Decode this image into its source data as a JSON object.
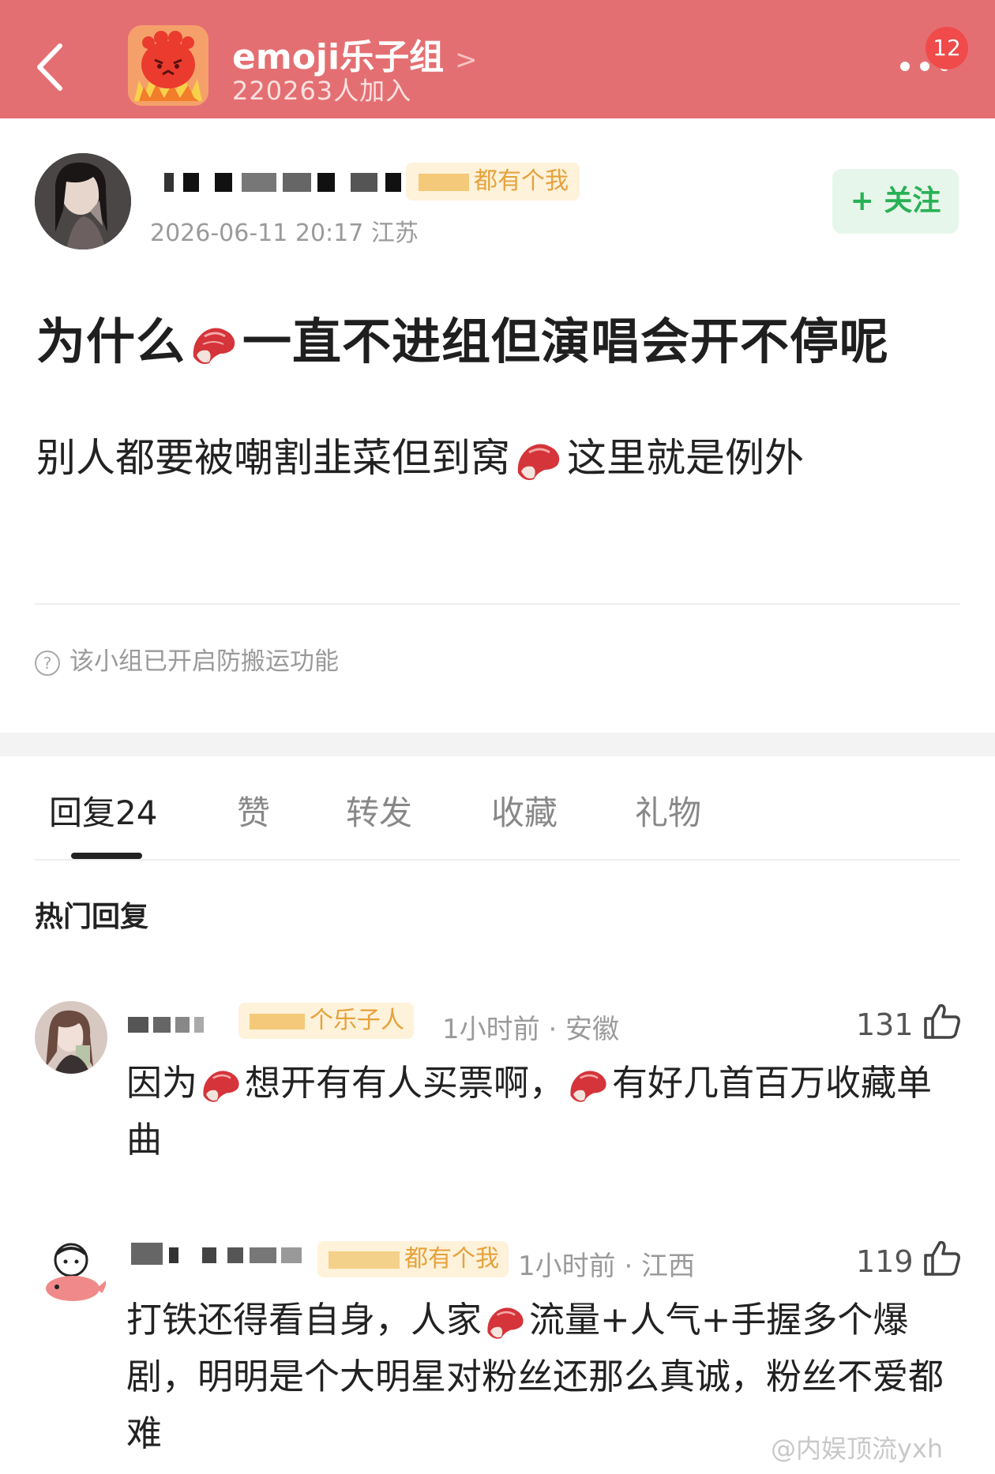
{
  "header": {
    "group_name": "emoji乐子组",
    "chevron": ">",
    "member_count": "220263人加入",
    "badge_count": "12"
  },
  "post": {
    "author_tag": "都有个我",
    "date_location": "2026-06-11 20:17 江苏",
    "follow_label": "+ 关注",
    "title_before": "为什么",
    "title_after": "一直不进组但演唱会开不停呢",
    "body_before": "别人都要被嘲割韭菜但到窝",
    "body_after": "这里就是例外",
    "notice": "该小组已开启防搬运功能"
  },
  "tabs": [
    {
      "label": "回复24"
    },
    {
      "label": "赞"
    },
    {
      "label": "转发"
    },
    {
      "label": "收藏"
    },
    {
      "label": "礼物"
    }
  ],
  "hot_replies_title": "热门回复",
  "comments": [
    {
      "tag": "个乐子人",
      "meta": "1小时前 · 安徽",
      "likes": "131",
      "text_1": "因为",
      "text_2": "想开有有人买票啊，",
      "text_3": "有好几首百万收藏单曲"
    },
    {
      "tag": "都有个我",
      "meta": "1小时前 · 江西",
      "likes": "119",
      "text_1": "打铁还得看自身，人家",
      "text_2": "流量+人气+手握多个爆剧，明明是个大明星对粉丝还那么真诚，粉丝不爱都难"
    }
  ],
  "watermark": "@内娱顶流yxh",
  "colors": {
    "header_bg": "#E46F72",
    "badge": "#F04A4A",
    "follow_green": "#29B155",
    "tag_orange": "#E5A23B"
  }
}
